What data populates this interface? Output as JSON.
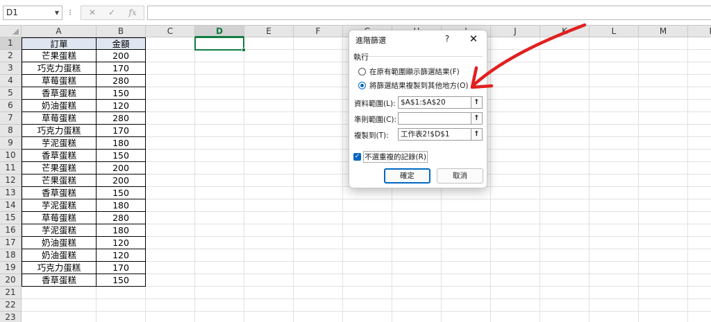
{
  "formula_bar": {
    "name_box": "D1",
    "separator": "⁝",
    "cancel_icon": "✕",
    "enter_icon": "✓",
    "fx_icon": "fx",
    "formula_value": ""
  },
  "columns": [
    "A",
    "B",
    "C",
    "D",
    "E",
    "F",
    "G",
    "H",
    "I",
    "J",
    "K",
    "L",
    "M",
    "N"
  ],
  "rows": [
    "1",
    "2",
    "3",
    "4",
    "5",
    "6",
    "7",
    "8",
    "9",
    "10",
    "11",
    "12",
    "13",
    "14",
    "15",
    "16",
    "17",
    "18",
    "19",
    "20",
    "21",
    "22",
    "23"
  ],
  "table": {
    "headers": [
      "訂單",
      "金額"
    ],
    "records": [
      [
        "芒果蛋糕",
        "200"
      ],
      [
        "巧克力蛋糕",
        "170"
      ],
      [
        "草莓蛋糕",
        "280"
      ],
      [
        "香草蛋糕",
        "150"
      ],
      [
        "奶油蛋糕",
        "120"
      ],
      [
        "草莓蛋糕",
        "280"
      ],
      [
        "巧克力蛋糕",
        "170"
      ],
      [
        "芋泥蛋糕",
        "180"
      ],
      [
        "香草蛋糕",
        "150"
      ],
      [
        "芒果蛋糕",
        "200"
      ],
      [
        "芒果蛋糕",
        "200"
      ],
      [
        "香草蛋糕",
        "150"
      ],
      [
        "芋泥蛋糕",
        "180"
      ],
      [
        "草莓蛋糕",
        "280"
      ],
      [
        "芋泥蛋糕",
        "180"
      ],
      [
        "奶油蛋糕",
        "120"
      ],
      [
        "奶油蛋糕",
        "120"
      ],
      [
        "巧克力蛋糕",
        "170"
      ],
      [
        "香草蛋糕",
        "150"
      ]
    ]
  },
  "dialog": {
    "title": "進階篩選",
    "help": "?",
    "close": "✕",
    "section": "執行",
    "option_in_place": "在原有範圍顯示篩選結果(F)",
    "option_copy": "將篩選結果複製到其他地方(O)",
    "list_range_label": "資料範圍(L):",
    "list_range_value": "$A$1:$A$20",
    "criteria_range_label": "準則範圍(C):",
    "criteria_range_value": "",
    "copy_to_label": "複製到(T):",
    "copy_to_value": "工作表2!$D$1",
    "unique_label": "不選重複的記錄(R)",
    "unique_checked": "✓",
    "range_btn": "⭡",
    "ok": "確定",
    "cancel": "取消"
  },
  "colors": {
    "accent_green": "#107c41",
    "dialog_blue": "#0067c0",
    "table_header_fill": "#dfe5f1",
    "annotation_red": "#e02020"
  }
}
